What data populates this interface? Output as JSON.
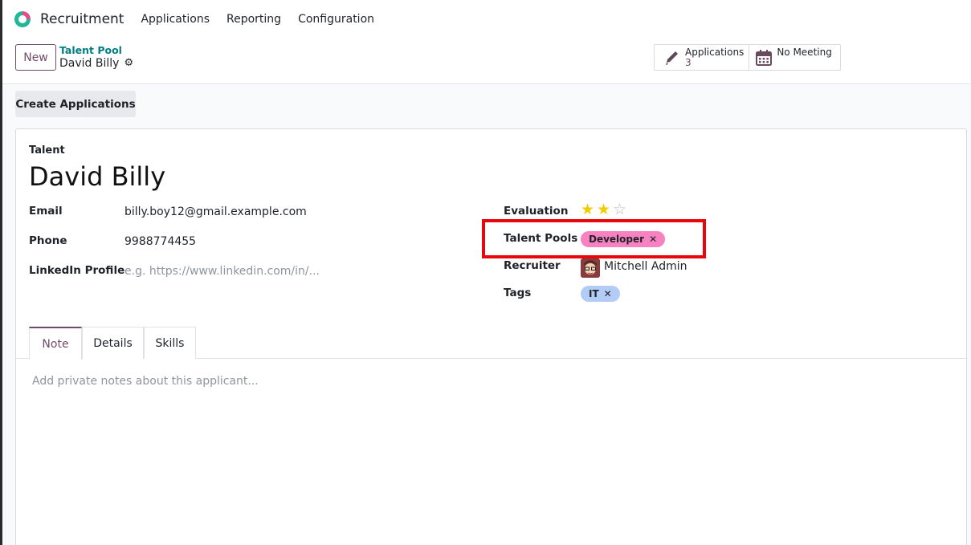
{
  "nav": {
    "app_name": "Recruitment",
    "menu": [
      "Applications",
      "Reporting",
      "Configuration"
    ]
  },
  "control": {
    "new_label": "New",
    "breadcrumb_parent": "Talent Pool",
    "breadcrumb_current": "David Billy"
  },
  "smart_buttons": {
    "applications_label": "Applications",
    "applications_count": "3",
    "meeting_label": "No Meeting"
  },
  "actions": {
    "create_applications": "Create Applications"
  },
  "form": {
    "section_label": "Talent",
    "name": "David Billy",
    "email_label": "Email",
    "email_value": "billy.boy12@gmail.example.com",
    "phone_label": "Phone",
    "phone_value": "9988774455",
    "linkedin_label": "LinkedIn Profile",
    "linkedin_placeholder": "e.g. https://www.linkedin.com/in/...",
    "evaluation_label": "Evaluation",
    "evaluation_stars": 2,
    "evaluation_max": 3,
    "talent_pools_label": "Talent Pools",
    "talent_pools": [
      "Developer"
    ],
    "recruiter_label": "Recruiter",
    "recruiter_value": "Mitchell Admin",
    "tags_label": "Tags",
    "tags": [
      "IT"
    ]
  },
  "tabs": [
    "Note",
    "Details",
    "Skills"
  ],
  "note_placeholder": "Add private notes about this applicant...",
  "colors": {
    "accent": "#714b67",
    "link": "#017e84",
    "pool_tag": "#f781c1",
    "it_tag": "#b3ccf5",
    "highlight": "#e8080b",
    "star_on": "#f3cc00"
  }
}
